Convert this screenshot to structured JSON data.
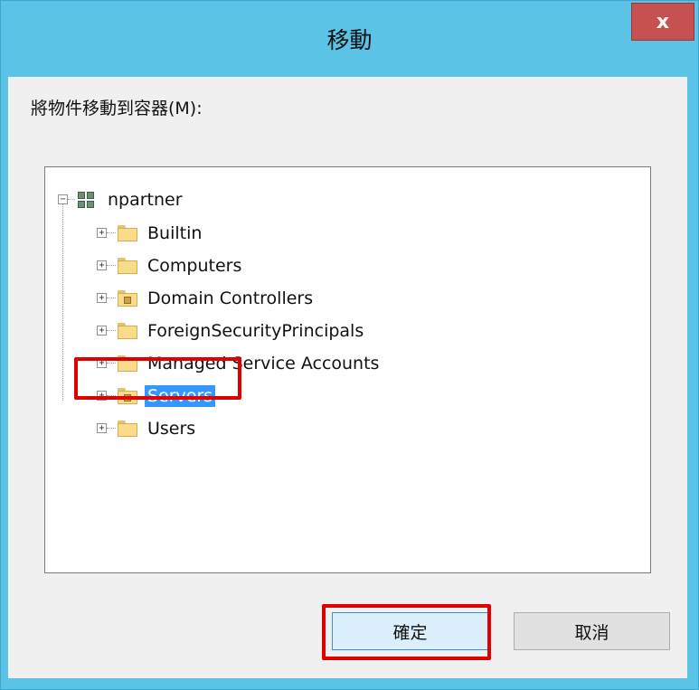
{
  "window": {
    "title": "移動",
    "close_label": "x"
  },
  "dialog": {
    "prompt": "將物件移動到容器(M):",
    "ok_label": "確定",
    "cancel_label": "取消"
  },
  "tree": {
    "root": {
      "label": "npartner",
      "icon": "domain-icon",
      "expanded": true
    },
    "items": [
      {
        "label": "Builtin",
        "icon": "folder-icon",
        "selected": false
      },
      {
        "label": "Computers",
        "icon": "folder-icon",
        "selected": false
      },
      {
        "label": "Domain Controllers",
        "icon": "ou-folder-icon",
        "selected": false
      },
      {
        "label": "ForeignSecurityPrincipals",
        "icon": "folder-icon",
        "selected": false
      },
      {
        "label": "Managed Service Accounts",
        "icon": "folder-icon",
        "selected": false
      },
      {
        "label": "Servers",
        "icon": "ou-folder-icon",
        "selected": true
      },
      {
        "label": "Users",
        "icon": "folder-icon",
        "selected": false
      }
    ]
  },
  "colors": {
    "titlebar": "#5bc4e6",
    "close_button": "#c75050",
    "selection": "#3399ff",
    "highlight_box": "#e00000"
  }
}
